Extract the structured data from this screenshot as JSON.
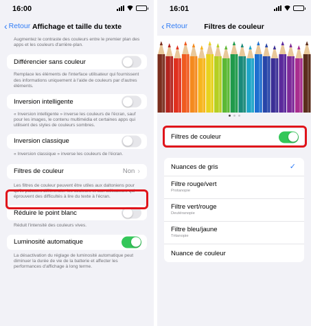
{
  "left": {
    "status_time": "16:00",
    "nav": {
      "back": "Retour",
      "title": "Affichage et taille du texte"
    },
    "top_desc": "Augmentez le contraste des couleurs entre le premier plan des apps et les couleurs d'arrière-plan.",
    "rows": [
      {
        "label": "Différencier sans couleur",
        "toggle": "off",
        "desc": "Remplace les éléments de l'interface utilisateur qui fournissent des informations uniquement à l'aide de couleurs par d'autres éléments."
      },
      {
        "label": "Inversion intelligente",
        "toggle": "off",
        "desc": "« Inversion intelligente » inverse les couleurs de l'écran, sauf pour les images, le contenu multimédia et certaines apps qui utilisent des styles de couleurs sombres."
      },
      {
        "label": "Inversion classique",
        "toggle": "off",
        "desc": "« Inversion classique » inverse les couleurs de l'écran."
      },
      {
        "label": "Filtres de couleur",
        "value": "Non",
        "desc": "Les filtres de couleur peuvent être utiles aux daltoniens pour qu'ils puissent différencier les couleurs et aux utilisateurs qui éprouvent des difficultés à lire du texte à l'écran."
      },
      {
        "label": "Réduire le point blanc",
        "toggle": "off",
        "desc": "Réduit l'intensité des couleurs vives."
      },
      {
        "label": "Luminosité automatique",
        "toggle": "on",
        "desc": "La désactivation du réglage de luminosité automatique peut diminuer la durée de vie de la batterie et affecter les performances d'affichage à long terme."
      }
    ]
  },
  "right": {
    "status_time": "16:01",
    "nav": {
      "back": "Retour",
      "title": "Filtres de couleur"
    },
    "toggle_label": "Filtres de couleur",
    "toggle_state": "on",
    "options": [
      {
        "label": "Nuances de gris",
        "sub": "",
        "selected": true
      },
      {
        "label": "Filtre rouge/vert",
        "sub": "Protanopie",
        "selected": false
      },
      {
        "label": "Filtre vert/rouge",
        "sub": "Deutéranopie",
        "selected": false
      },
      {
        "label": "Filtre bleu/jaune",
        "sub": "Tritanopie",
        "selected": false
      },
      {
        "label": "Nuance de couleur",
        "sub": "",
        "selected": false
      }
    ]
  },
  "colors": {
    "accent": "#2e7bf6",
    "toggle_on": "#34c759",
    "highlight": "#e0131a",
    "pencils": [
      "#7a2e1e",
      "#b3241e",
      "#e0301e",
      "#ef5a1f",
      "#f48a1e",
      "#f7b51e",
      "#e8d21e",
      "#b6cf23",
      "#5bb834",
      "#1f9a4b",
      "#1a8a7a",
      "#1ea5c8",
      "#1e6fd0",
      "#2745a8",
      "#3b2e96",
      "#5b2a9c",
      "#7d2a99",
      "#a82d8f",
      "#5a2c1c"
    ]
  }
}
